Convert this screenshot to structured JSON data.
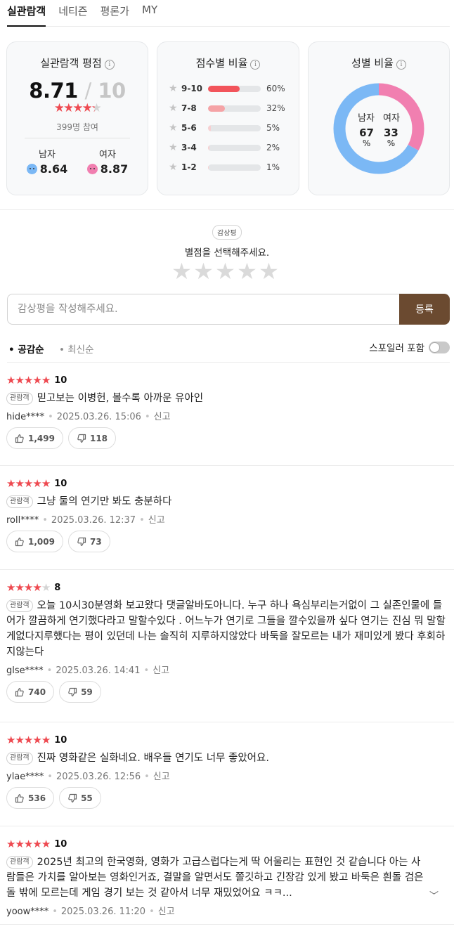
{
  "tabs": [
    {
      "label": "실관람객"
    },
    {
      "label": "네티즌"
    },
    {
      "label": "평론가"
    },
    {
      "label": "MY"
    }
  ],
  "score_card": {
    "title": "실관람객 평점",
    "score": "8.71",
    "slash": "/",
    "max": "10",
    "participants": "399명 참여",
    "star_rating_of_5": 4.35,
    "male_label": "남자",
    "male_score": "8.64",
    "female_label": "여자",
    "female_score": "8.87"
  },
  "ratio_card": {
    "title": "점수별 비율",
    "rows": [
      {
        "label": "9-10",
        "pct": 60,
        "text": "60%"
      },
      {
        "label": "7-8",
        "pct": 32,
        "text": "32%"
      },
      {
        "label": "5-6",
        "pct": 5,
        "text": "5%"
      },
      {
        "label": "3-4",
        "pct": 2,
        "text": "2%"
      },
      {
        "label": "1-2",
        "pct": 1,
        "text": "1%"
      }
    ],
    "strong_color": "#f2545b",
    "light_color": "#f5a3a6",
    "faint_color": "#f7d0d2"
  },
  "gender_card": {
    "title": "성별 비율",
    "male_label": "남자",
    "female_label": "여자",
    "male_pct": "67",
    "female_pct": "33",
    "unit": "%",
    "male_color": "#7bb8f5",
    "female_color": "#f17fb0"
  },
  "write": {
    "badge": "감상평",
    "select_msg": "별점을 선택해주세요.",
    "placeholder": "감상평을 작성해주세요.",
    "submit_label": "등록"
  },
  "sort": {
    "active": "• 공감순",
    "inactive": "• 최신순",
    "spoiler_label": "스포일러 포함"
  },
  "reviews": [
    {
      "stars": 5,
      "score": "10",
      "badge": "관람객",
      "text": "믿고보는 이병헌, 볼수록 아까운 유아인",
      "user": "hide****",
      "date": "2025.03.26. 15:06",
      "report": "신고",
      "likes": "1,499",
      "dislikes": "118"
    },
    {
      "stars": 5,
      "score": "10",
      "badge": "관람객",
      "text": "그냥 둘의 연기만 봐도 충분하다",
      "user": "roll****",
      "date": "2025.03.26. 12:37",
      "report": "신고",
      "likes": "1,009",
      "dislikes": "73"
    },
    {
      "stars": 4,
      "score": "8",
      "badge": "관람객",
      "text": "오늘 10시30분영화 보고왔다 댓글알바도아니다. 누구 하나 욕심부리는거없이 그 실존인물에 들어가 깔끔하게 연기했다라고 말할수있다 . 어느누가 연기로 그들을 깔수있을까 싶다 연기는 진심 뭐 말할게없다지루했다는 평이 있던데 나는 솔직히 지루하지않았다 바둑을 잘모르는 내가 재미있게 봤다 후회하지않는다",
      "user": "glse****",
      "date": "2025.03.26. 14:41",
      "report": "신고",
      "likes": "740",
      "dislikes": "59"
    },
    {
      "stars": 5,
      "score": "10",
      "badge": "관람객",
      "text": "진짜 영화같은 실화네요. 배우들 연기도 너무 좋았어요.",
      "user": "ylae****",
      "date": "2025.03.26. 12:56",
      "report": "신고",
      "likes": "536",
      "dislikes": "55"
    },
    {
      "stars": 5,
      "score": "10",
      "badge": "관람객",
      "text": "2025년 최고의 한국영화, 영화가 고급스럽다는게 딱 어울리는 표현인 것 같습니다 아는 사람들은 가치를 알아보는 영화인거죠, 결말을 알면서도 쫄깃하고 긴장감 있게 봤고 바둑은 흰돌 검은돌 밖에 모르는데 게임 경기 보는 것 같아서 너무 재밌었어요 ㅋㅋ...",
      "user": "yoow****",
      "date": "2025.03.26. 11:20",
      "report": "신고"
    }
  ],
  "colors": {
    "star_red": "#ee4950",
    "star_gray": "#d4d4d4",
    "submit_brown": "#6b4a30"
  }
}
